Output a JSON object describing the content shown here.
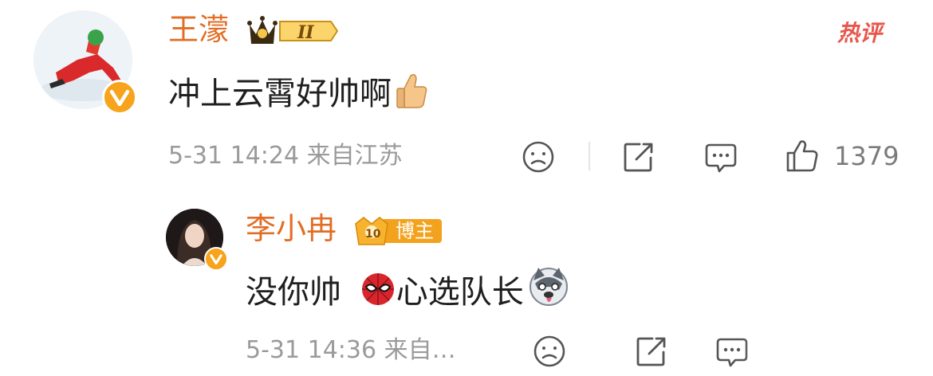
{
  "hot_label": "热评",
  "comment": {
    "username": "王濛",
    "text": "冲上云霄好帅啊",
    "meta": "5-31 14:24 来自江苏",
    "likes": "1379",
    "emoji_icon": "thumbs-up-emoji-icon"
  },
  "reply": {
    "username": "李小冉",
    "badge_label": "博主",
    "badge_level": "10",
    "text_part1": "没你帅",
    "text_part2": "心选队长",
    "meta": "5-31 14:36 来自…"
  },
  "colors": {
    "username": "#e26d24",
    "meta": "#9a9a9a",
    "hot": "#e8574d",
    "vip_badge": "#f7a31b"
  }
}
